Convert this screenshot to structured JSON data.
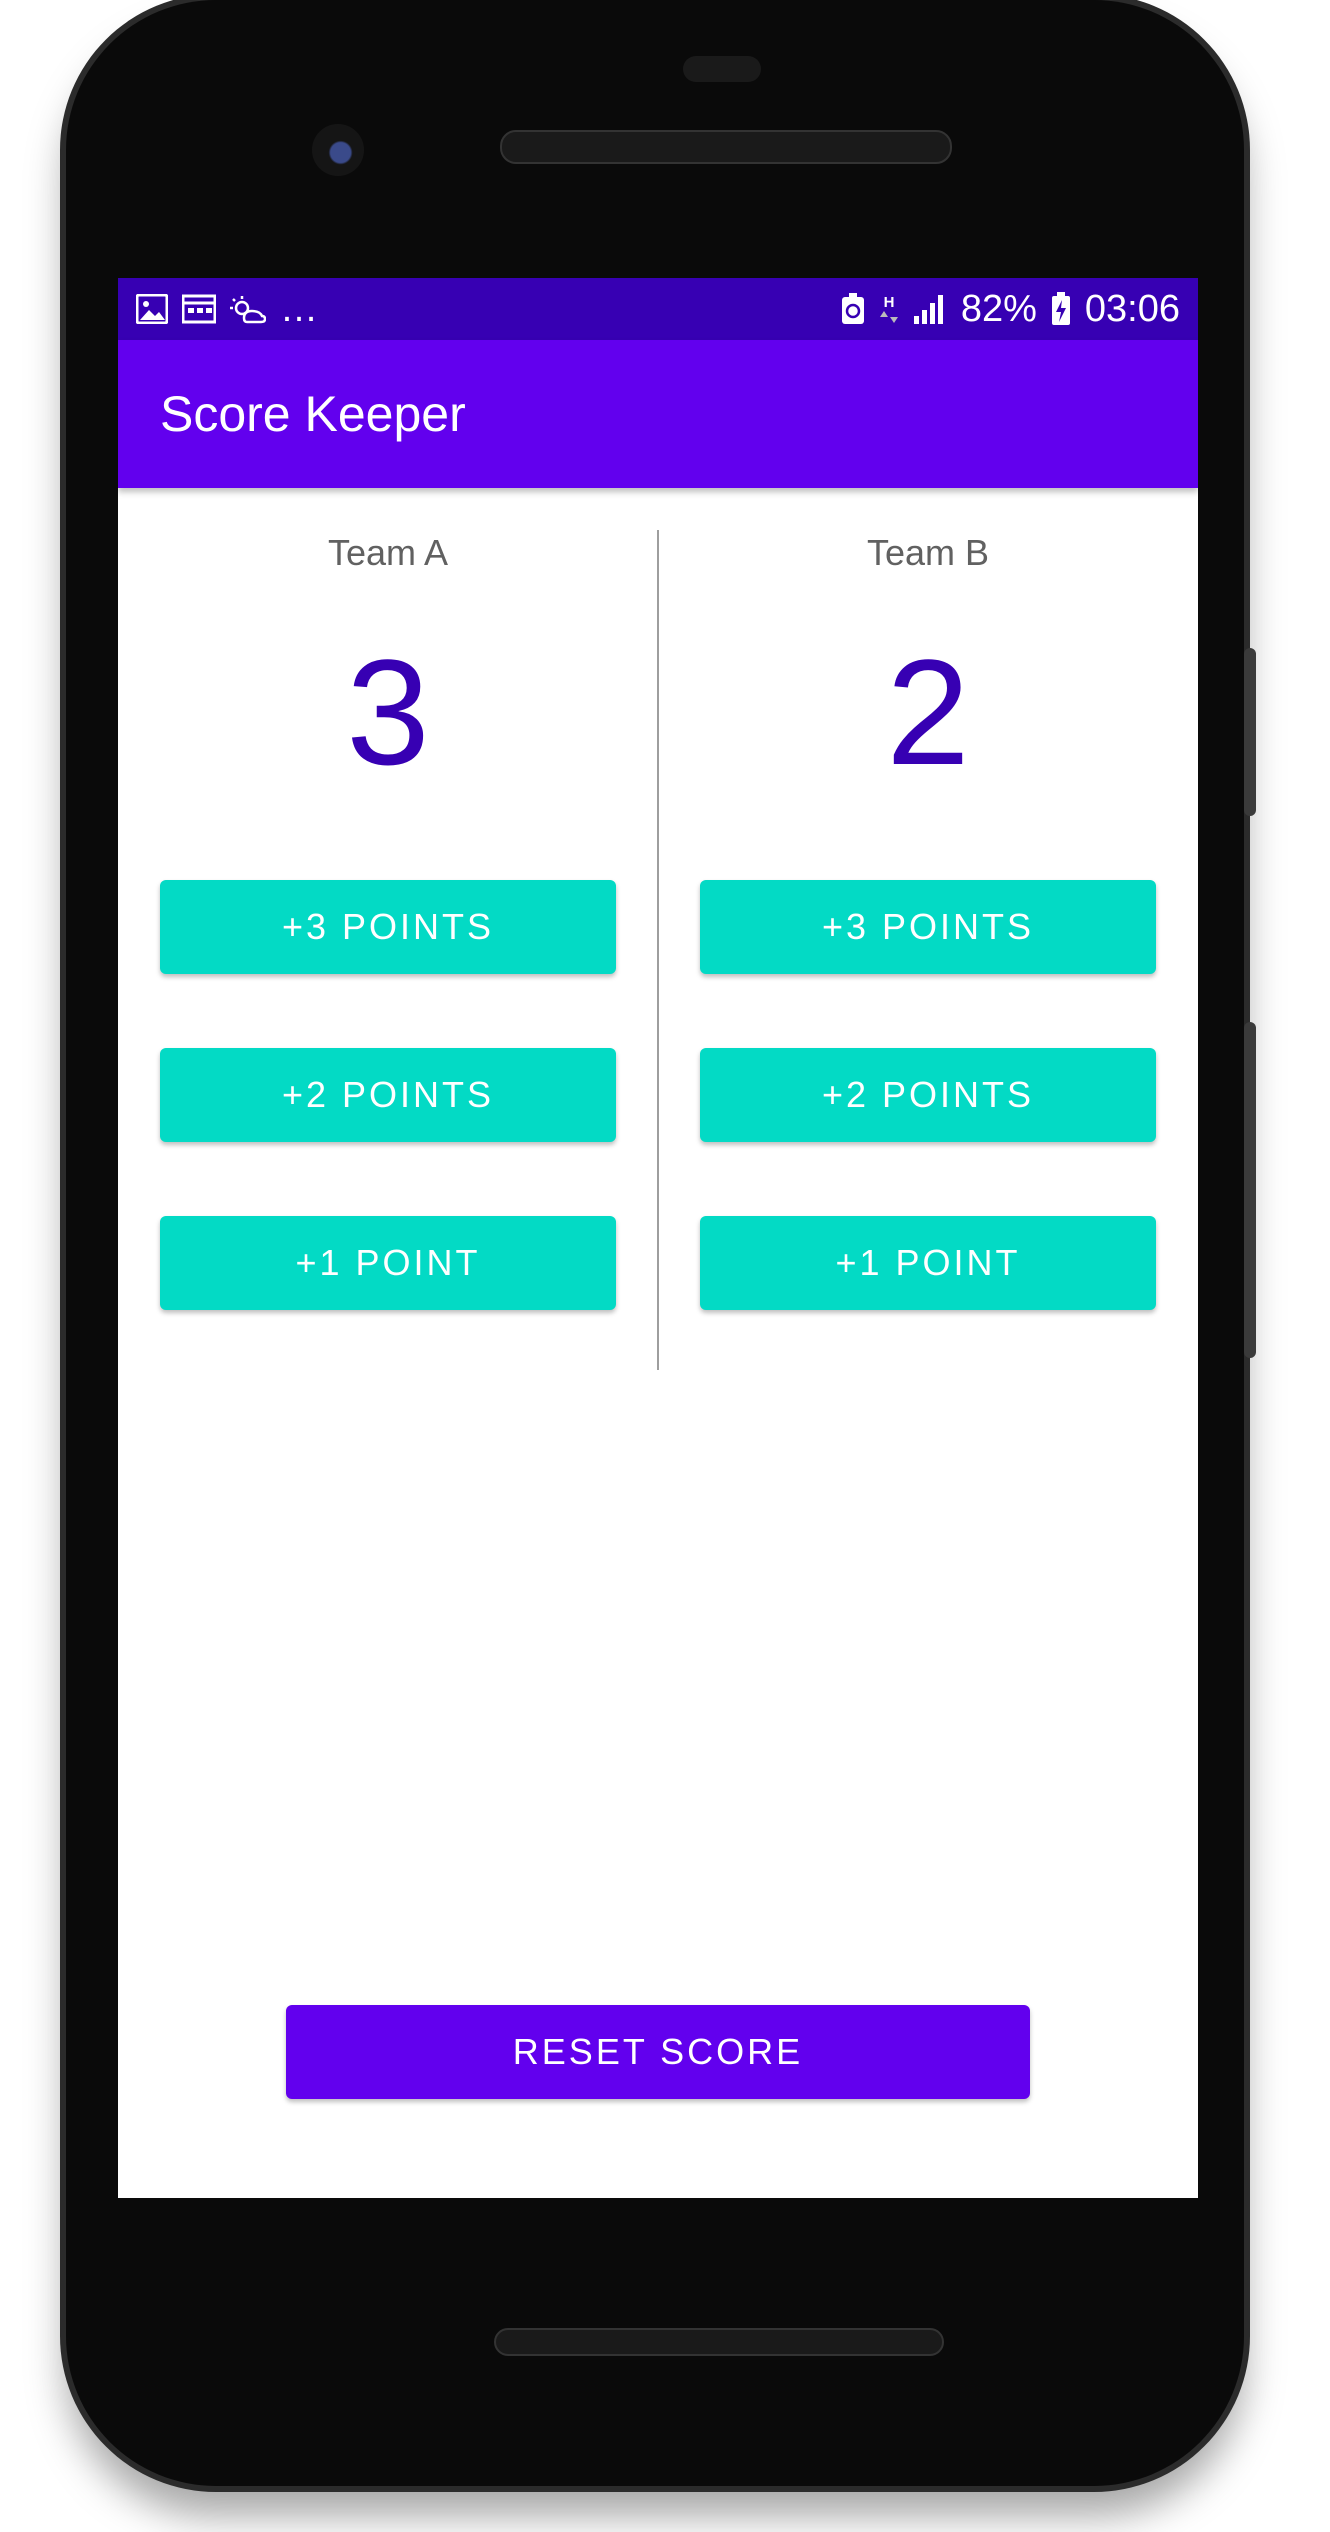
{
  "status_bar": {
    "notif_icons": [
      "image-icon",
      "calendar-icon",
      "weather-icon"
    ],
    "overflow": "…",
    "network_type": "H",
    "battery_percent": "82%",
    "time": "03:06"
  },
  "app_bar": {
    "title": "Score Keeper"
  },
  "team_a": {
    "label": "Team A",
    "score": "3",
    "buttons": [
      "+3 POINTS",
      "+2 POINTS",
      "+1 POINT"
    ]
  },
  "team_b": {
    "label": "Team B",
    "score": "2",
    "buttons": [
      "+3 POINTS",
      "+2 POINTS",
      "+1 POINT"
    ]
  },
  "reset_label": "RESET SCORE",
  "colors": {
    "primary": "#6200EE",
    "primary_dark": "#3700B3",
    "accent": "#03DAC5"
  }
}
